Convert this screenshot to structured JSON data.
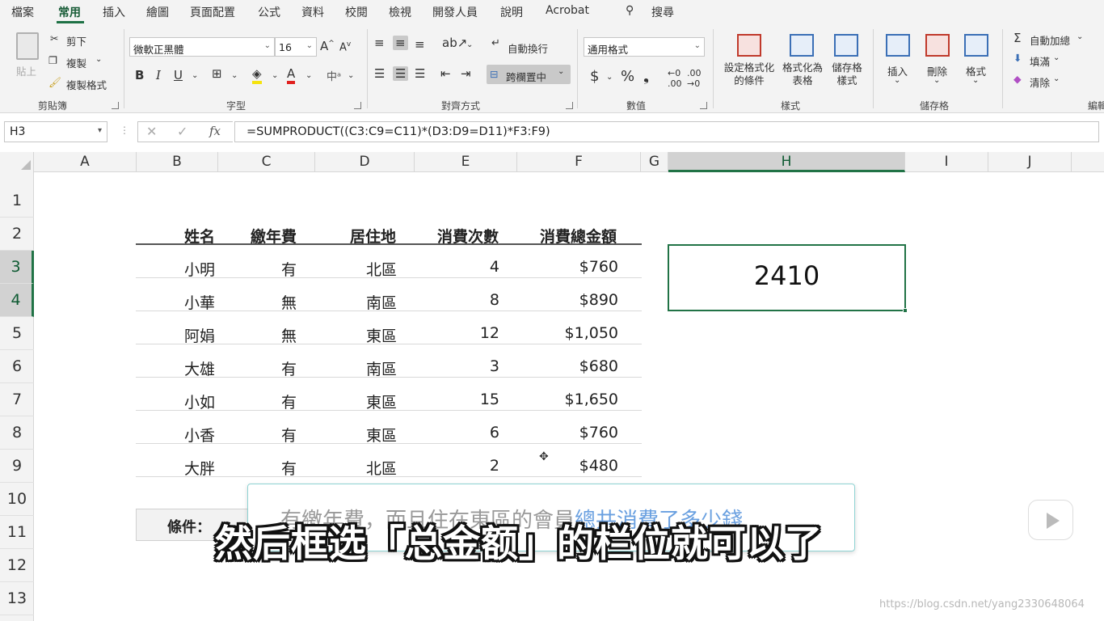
{
  "tabs": [
    "檔案",
    "常用",
    "插入",
    "繪圖",
    "頁面配置",
    "公式",
    "資料",
    "校閱",
    "檢視",
    "開發人員",
    "說明",
    "Acrobat",
    "搜尋"
  ],
  "ribbon": {
    "clipboard": {
      "paste": "貼上",
      "cut": "剪下",
      "copy": "複製",
      "format_painter": "複製格式",
      "label": "剪貼簿"
    },
    "font": {
      "name": "微軟正黑體",
      "size": "16",
      "label": "字型",
      "bold": "B",
      "italic": "I",
      "underline": "U"
    },
    "alignment": {
      "wrap": "自動換行",
      "merge": "跨欄置中",
      "label": "對齊方式"
    },
    "number": {
      "format": "通用格式",
      "label": "數值"
    },
    "styles": {
      "cond_format": "設定格式化的條件",
      "table_format": "格式化為表格",
      "cell_style": "儲存格樣式",
      "label": "樣式"
    },
    "cells": {
      "insert": "插入",
      "delete": "刪除",
      "format": "格式",
      "label": "儲存格"
    },
    "editing": {
      "autosum": "自動加總",
      "fill": "填滿",
      "clear": "清除",
      "label": "編輯"
    }
  },
  "formula_bar": {
    "name_box": "H3",
    "formula": "=SUMPRODUCT((C3:C9=C11)*(D3:D9=D11)*F3:F9)"
  },
  "columns": [
    "A",
    "B",
    "C",
    "D",
    "E",
    "F",
    "G",
    "H",
    "I",
    "J"
  ],
  "rows": [
    "1",
    "2",
    "3",
    "4",
    "5",
    "6",
    "7",
    "8",
    "9",
    "10",
    "11",
    "12",
    "13"
  ],
  "table": {
    "headers": [
      "姓名",
      "繳年費",
      "居住地",
      "消費次數",
      "消費總金額"
    ],
    "rows": [
      [
        "小明",
        "有",
        "北區",
        "4",
        "$760"
      ],
      [
        "小華",
        "無",
        "南區",
        "8",
        "$890"
      ],
      [
        "阿娟",
        "無",
        "東區",
        "12",
        "$1,050"
      ],
      [
        "大雄",
        "有",
        "南區",
        "3",
        "$680"
      ],
      [
        "小如",
        "有",
        "東區",
        "15",
        "$1,650"
      ],
      [
        "小香",
        "有",
        "東區",
        "6",
        "$760"
      ],
      [
        "大胖",
        "有",
        "北區",
        "2",
        "$480"
      ]
    ]
  },
  "result_value": "2410",
  "condition_label": "條件：",
  "popup": {
    "text_plain": "有繳年費，而且住在東區的會員",
    "text_highlight": "總共消費了多少錢"
  },
  "subtitle": "然后框选「总金额」的栏位就可以了",
  "watermark": "https://blog.csdn.net/yang2330648064"
}
